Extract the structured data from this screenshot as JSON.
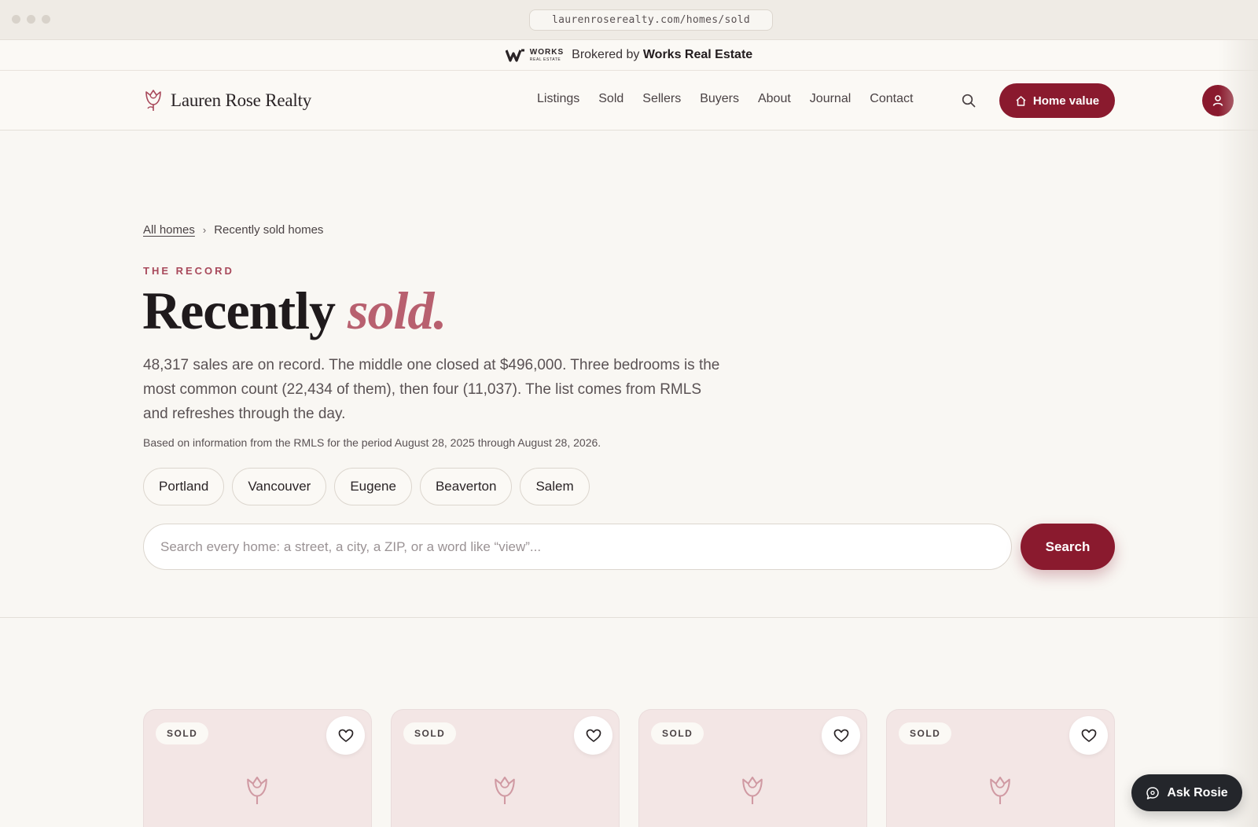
{
  "browser": {
    "url": "laurenroserealty.com/homes/sold"
  },
  "broker_bar": {
    "logo_text": "WORKS",
    "logo_subtext": "REAL ESTATE",
    "prefix": "Brokered by",
    "broker_name": "Works Real Estate"
  },
  "header": {
    "brand_name": "Lauren Rose Realty",
    "nav": [
      "Listings",
      "Sold",
      "Sellers",
      "Buyers",
      "About",
      "Journal",
      "Contact"
    ],
    "home_value_label": "Home value"
  },
  "hero": {
    "breadcrumb": {
      "root": "All homes",
      "current": "Recently sold homes"
    },
    "eyebrow": "THE RECORD",
    "title_main": "Recently",
    "title_accent": "sold.",
    "lede": "48,317 sales are on record. The middle one closed at $496,000. Three bedrooms is the most common count (22,434 of them), then four (11,037). The list comes from RMLS and refreshes through the day.",
    "fineprint": "Based on information from the RMLS for the period August 28, 2025 through August 28, 2026.",
    "cities": [
      "Portland",
      "Vancouver",
      "Eugene",
      "Beaverton",
      "Salem"
    ],
    "search": {
      "placeholder": "Search every home: a street, a city, a ZIP, or a word like “view”...",
      "value": "",
      "button_label": "Search"
    }
  },
  "cards": [
    {
      "badge": "SOLD"
    },
    {
      "badge": "SOLD"
    },
    {
      "badge": "SOLD"
    },
    {
      "badge": "SOLD"
    }
  ],
  "chat": {
    "label": "Ask Rosie"
  },
  "colors": {
    "brand": "#8a1a2e",
    "accent": "#b8606f",
    "eyebrow": "#a8495b",
    "card_bg": "#f3e6e5",
    "chat_bg": "#24262b"
  },
  "icons": {
    "brand": "rose-icon",
    "search": "search-icon",
    "home_value": "home-icon",
    "account": "user-icon",
    "favorite": "heart-icon",
    "placeholder": "rose-icon",
    "chat": "chat-bubble-icon"
  }
}
